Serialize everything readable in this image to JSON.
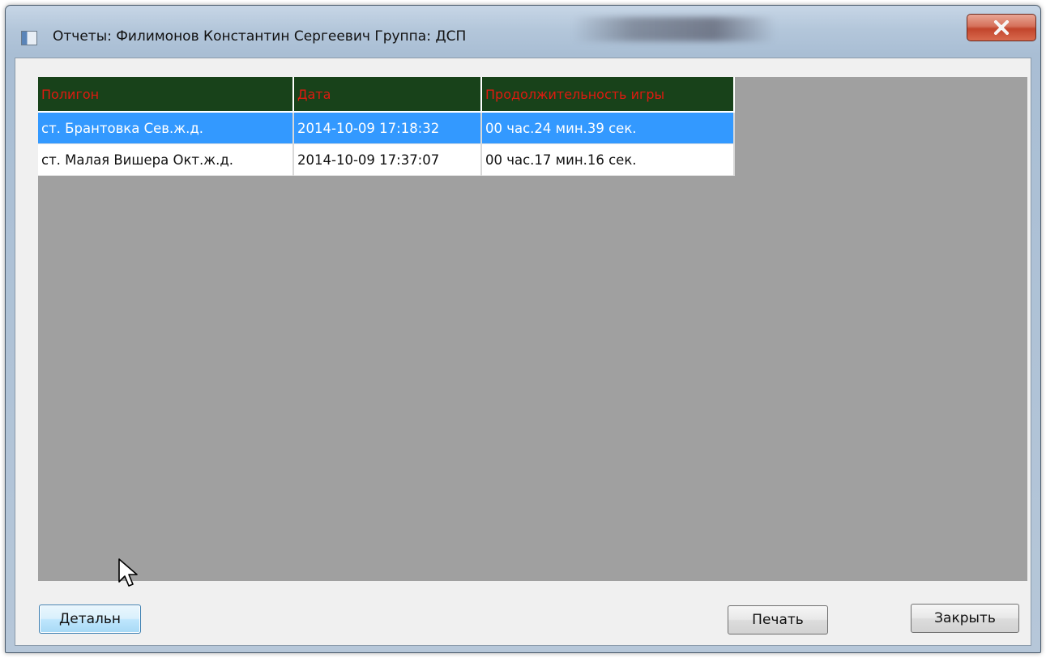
{
  "window": {
    "title": "Отчеты: Филимонов Константин Сергеевич Группа: ДСП"
  },
  "grid": {
    "columns": [
      "Полигон",
      "Дата",
      "Продолжительность игры"
    ],
    "rows": [
      [
        "ст. Брантовка Сев.ж.д.",
        "2014-10-09 17:18:32",
        "00 час.24 мин.39 сек."
      ],
      [
        "ст. Малая Вишера Окт.ж.д.",
        "2014-10-09 17:37:07",
        "00 час.17 мин.16 сек."
      ]
    ],
    "selected_row": 0
  },
  "buttons": {
    "details_label": "Детальн",
    "print_label": "Печать",
    "close_label": "Закрыть"
  },
  "colors": {
    "header_bg": "#18421a",
    "header_text": "#e01a10",
    "selection": "#3399ff",
    "empty_area": "#a0a0a0"
  },
  "icons": [
    "app-icon",
    "close-x-icon",
    "mouse-pointer-icon"
  ]
}
